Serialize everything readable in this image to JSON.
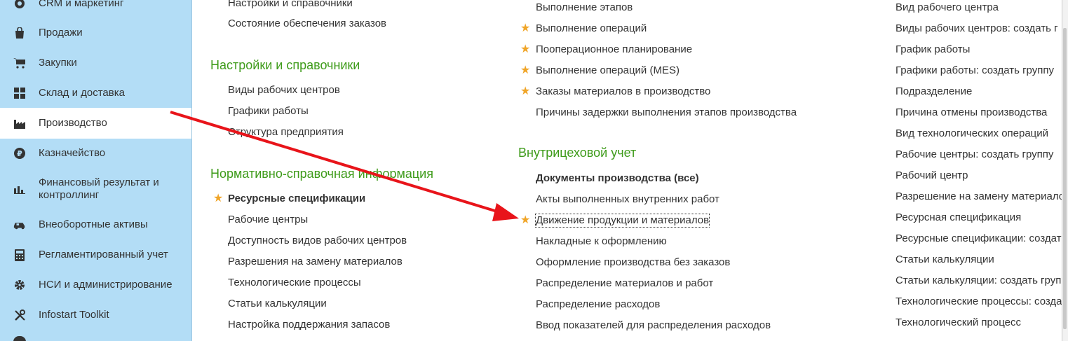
{
  "sidebar": {
    "items": [
      {
        "label": "CRM и маркетинг",
        "icon": "crm-icon"
      },
      {
        "label": "Продажи",
        "icon": "shopping-bag-icon"
      },
      {
        "label": "Закупки",
        "icon": "cart-icon"
      },
      {
        "label": "Склад и доставка",
        "icon": "warehouse-icon"
      },
      {
        "label": "Производство",
        "icon": "factory-icon",
        "active": true
      },
      {
        "label": "Казначейство",
        "icon": "ruble-icon"
      },
      {
        "label": "Финансовый результат и\nконтроллинг",
        "icon": "bar-chart-icon"
      },
      {
        "label": "Внеоборотные активы",
        "icon": "car-icon"
      },
      {
        "label": "Регламентированный учет",
        "icon": "calculator-icon"
      },
      {
        "label": "НСИ и администрирование",
        "icon": "gear-icon"
      },
      {
        "label": "Infostart Toolkit",
        "icon": "tools-icon"
      }
    ]
  },
  "col1": {
    "top_links": [
      "Настройки и справочники",
      "Состояние обеспечения заказов"
    ],
    "group_settings": {
      "title": "Настройки и справочники",
      "links": [
        "Виды рабочих центров",
        "Графики работы",
        "Структура предприятия"
      ]
    },
    "group_nsi": {
      "title": "Нормативно-справочная информация",
      "links": [
        "Ресурсные спецификации",
        "Рабочие центры",
        "Доступность видов рабочих центров",
        "Разрешения на замену материалов",
        "Технологические процессы",
        "Статьи калькуляции",
        "Настройка поддержания запасов"
      ]
    }
  },
  "col2": {
    "top_links": [
      "Выполнение этапов",
      "Выполнение операций",
      "Пооперационное планирование",
      "Выполнение операций (MES)",
      "Заказы материалов в производство",
      "Причины задержки выполнения этапов производства"
    ],
    "group_workshop": {
      "title": "Внутрицеховой учет",
      "links": [
        "Документы производства (все)",
        "Акты выполненных внутренних работ",
        "Движение продукции и материалов",
        "Накладные к оформлению",
        "Оформление производства без заказов",
        "Распределение материалов и работ",
        "Распределение расходов",
        "Ввод показателей для распределения расходов"
      ]
    }
  },
  "col3": {
    "links": [
      "Вид рабочего центра",
      "Виды рабочих центров: создать г",
      "График работы",
      "Графики работы: создать группу",
      "Подразделение",
      "Причина отмены производства",
      "Вид технологических операций",
      "Рабочие центры: создать группу",
      "Рабочий центр",
      "Разрешение на замену материало",
      "Ресурсная спецификация",
      "Ресурсные спецификации: создат",
      "Статьи калькуляции",
      "Статьи калькуляции: создать груп",
      "Технологические процессы: созда",
      "Технологический процесс"
    ]
  },
  "colors": {
    "sidebar_bg": "#b3ddf6",
    "group_title": "#3e9b1a",
    "star": "#f0a528",
    "arrow": "#e8141a"
  }
}
